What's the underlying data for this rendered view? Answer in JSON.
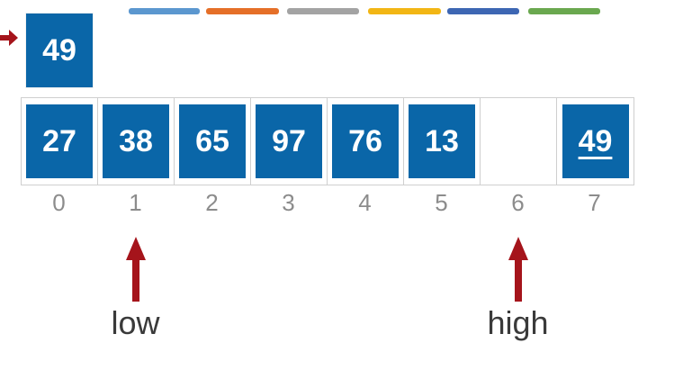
{
  "colors": {
    "box": "#0a66a8",
    "arrow": "#a5141b",
    "legend": [
      "#5b97cf",
      "#e56f28",
      "#a3a3a3",
      "#f2b615",
      "#3d66b3",
      "#6aa84f"
    ]
  },
  "pivot": {
    "value": "49"
  },
  "array": {
    "cells": [
      {
        "value": "27",
        "index": "0",
        "filled": true
      },
      {
        "value": "38",
        "index": "1",
        "filled": true
      },
      {
        "value": "65",
        "index": "2",
        "filled": true
      },
      {
        "value": "97",
        "index": "3",
        "filled": true
      },
      {
        "value": "76",
        "index": "4",
        "filled": true
      },
      {
        "value": "13",
        "index": "5",
        "filled": true
      },
      {
        "value": "",
        "index": "6",
        "filled": false
      },
      {
        "value": "49",
        "index": "7",
        "filled": true,
        "underlined": true
      }
    ]
  },
  "pointers": {
    "low": {
      "label": "low",
      "index": 1
    },
    "high": {
      "label": "high",
      "index": 6
    }
  }
}
